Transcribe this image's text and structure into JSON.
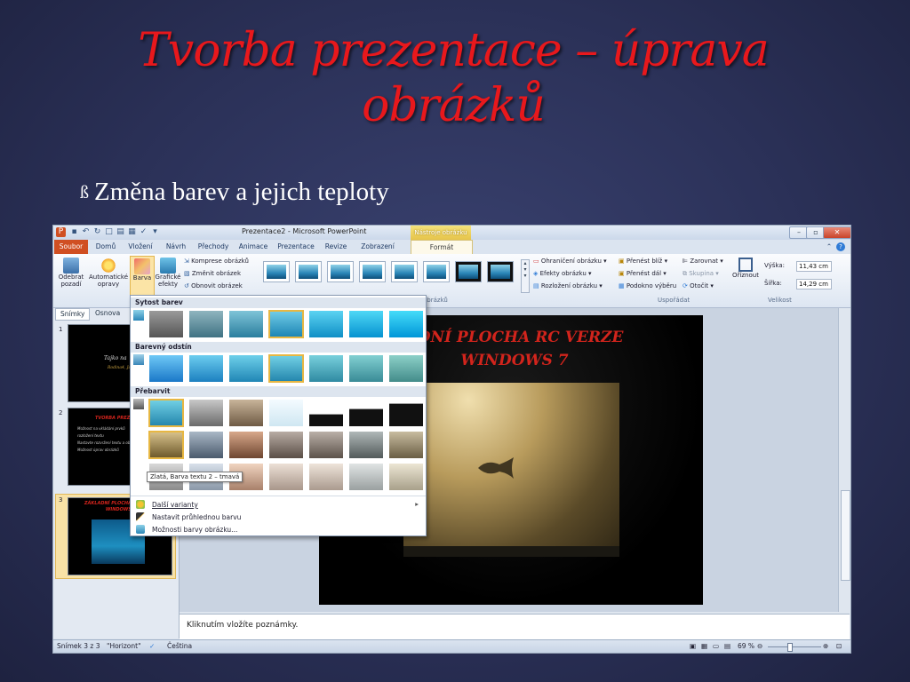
{
  "slide": {
    "title": "Tvorba prezentace – úprava obrázků",
    "bullet_symbol": "ß",
    "bullet_text": "Změna barev a jejich teploty"
  },
  "window": {
    "title": "Prezentace2 - Microsoft PowerPoint",
    "contextual_tab": "Nástroje obrázku"
  },
  "tabs": [
    "Soubor",
    "Domů",
    "Vložení",
    "Návrh",
    "Přechody",
    "Animace",
    "Prezentace",
    "Revize",
    "Zobrazení",
    "Formát"
  ],
  "ribbon": {
    "remove_bg": "Odebrat pozadí",
    "corrections": "Automatické opravy",
    "color": "Barva",
    "artistic": "Grafické efekty",
    "compress": "Komprese obrázků",
    "change": "Změnit obrázek",
    "reset": "Obnovit obrázek",
    "styles_group": "obrázků",
    "border": "Ohraničení obrázku",
    "effects": "Efekty obrázku",
    "layout": "Rozložení obrázku",
    "bring_forward": "Přenést blíž",
    "send_backward": "Přenést dál",
    "selection_pane": "Podokno výběru",
    "align": "Zarovnat",
    "group": "Skupina",
    "rotate": "Otočit",
    "arrange_group": "Uspořádat",
    "crop": "Oříznout",
    "height_label": "Výška:",
    "height_value": "11,43 cm",
    "width_label": "Šířka:",
    "width_value": "14,29 cm",
    "size_group": "Velikost"
  },
  "pane": {
    "tab_slides": "Snímky",
    "tab_outline": "Osnova",
    "thumbs": [
      {
        "num": "1",
        "title": "Tajko na",
        "sub": "Rodina4, Jan"
      },
      {
        "num": "2",
        "title": "TVORBA PREZENTACE",
        "lines": [
          "Možnost na vkládání prvků",
          "rozložení textu",
          "Nastavte rozvržení textu a obrázků",
          "Možnost úprav obrázků"
        ]
      },
      {
        "num": "3",
        "title": "ZÁKLADNÍ PLOCHA RC VERZE WINDOWS 7"
      }
    ]
  },
  "main_slide": {
    "heading_line1": "ADNÍ PLOCHA RC VERZE",
    "heading_line2": "WINDOWS 7"
  },
  "dropdown": {
    "section1": "Sytost barev",
    "section2": "Barevný odstín",
    "section3": "Přebarvit",
    "tooltip": "Zlatá, Barva textu 2 – tmavá",
    "more_variants": "Další varianty",
    "set_transparent": "Nastavit průhlednou barvu",
    "color_options": "Možnosti barvy obrázku...",
    "arrow": "▸"
  },
  "notes": {
    "placeholder": "Kliknutím vložíte poznámky."
  },
  "status": {
    "slide_of": "Snímek 3 z 3",
    "theme": "\"Horizont\"",
    "language": "Čeština",
    "zoom": "69 %"
  }
}
